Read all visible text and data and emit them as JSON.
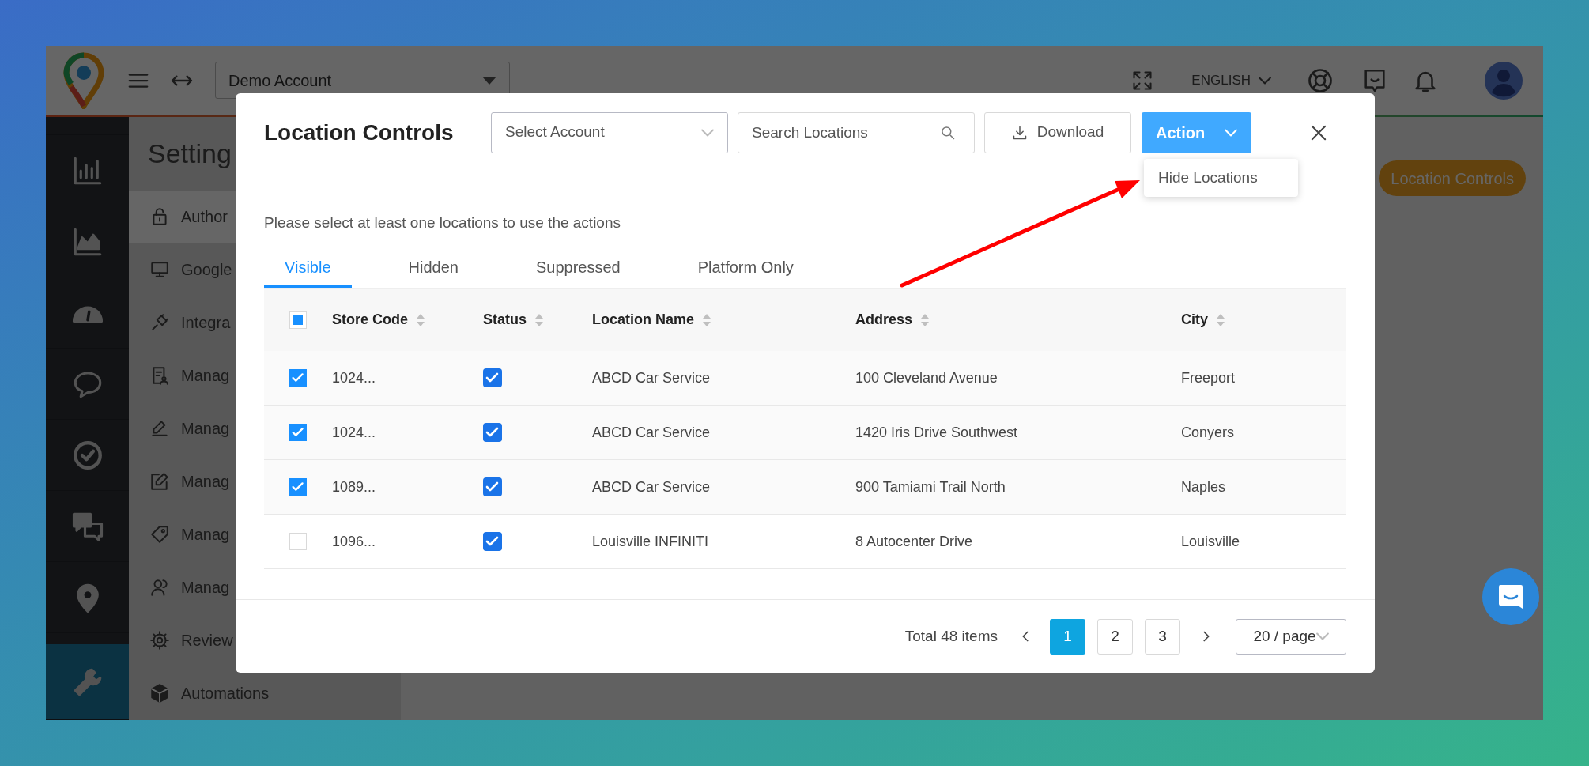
{
  "app": {
    "top_bar": {
      "account_select": "Demo Account",
      "language": "ENGLISH"
    },
    "nav_rail": [
      {
        "selected": false
      },
      {
        "selected": false
      },
      {
        "selected": false
      },
      {
        "selected": false
      },
      {
        "selected": false
      },
      {
        "selected": false
      },
      {
        "selected": false
      },
      {
        "selected": true
      }
    ],
    "settings": {
      "title": "Setting",
      "items": [
        {
          "label": "Author",
          "selected": true
        },
        {
          "label": "Google",
          "selected": false
        },
        {
          "label": "Integra",
          "selected": false
        },
        {
          "label": "Manag",
          "selected": false
        },
        {
          "label": "Manag",
          "selected": false
        },
        {
          "label": "Manag",
          "selected": false
        },
        {
          "label": "Manag",
          "selected": false
        },
        {
          "label": "Manag",
          "selected": false
        },
        {
          "label": "Review",
          "selected": false
        },
        {
          "label": "Automations",
          "selected": false
        }
      ]
    },
    "location_controls_button": "Location Controls"
  },
  "modal": {
    "title": "Location Controls",
    "account_select": {
      "placeholder": "Select Account"
    },
    "search": {
      "placeholder": "Search Locations"
    },
    "download_button": "Download",
    "action_button": "Action",
    "action_menu": [
      "Hide Locations"
    ],
    "helper_text": "Please select at least one locations to use the actions",
    "tabs": [
      {
        "label": "Visible",
        "selected": true
      },
      {
        "label": "Hidden",
        "selected": false
      },
      {
        "label": "Suppressed",
        "selected": false
      },
      {
        "label": "Platform Only",
        "selected": false
      }
    ],
    "table": {
      "select_all": {
        "indeterminate": true
      },
      "columns": [
        "Store Code",
        "Status",
        "Location Name",
        "Address",
        "City"
      ],
      "rows": [
        {
          "selected": true,
          "store_code": "1024...",
          "status_checked": true,
          "location_name": "ABCD Car Service",
          "address": "100 Cleveland Avenue",
          "city": "Freeport"
        },
        {
          "selected": true,
          "store_code": "1024...",
          "status_checked": true,
          "location_name": "ABCD Car Service",
          "address": "1420 Iris Drive Southwest",
          "city": "Conyers"
        },
        {
          "selected": true,
          "store_code": "1089...",
          "status_checked": true,
          "location_name": "ABCD Car Service",
          "address": "900 Tamiami Trail North",
          "city": "Naples"
        },
        {
          "selected": false,
          "store_code": "1096...",
          "status_checked": true,
          "location_name": "Louisville INFINITI",
          "address": "8 Autocenter Drive",
          "city": "Louisville"
        }
      ]
    },
    "pagination": {
      "total": "Total 48 items",
      "pages": [
        {
          "label": "1",
          "selected": true
        },
        {
          "label": "2",
          "selected": false
        },
        {
          "label": "3",
          "selected": false
        }
      ],
      "page_size": "20 / page"
    }
  }
}
